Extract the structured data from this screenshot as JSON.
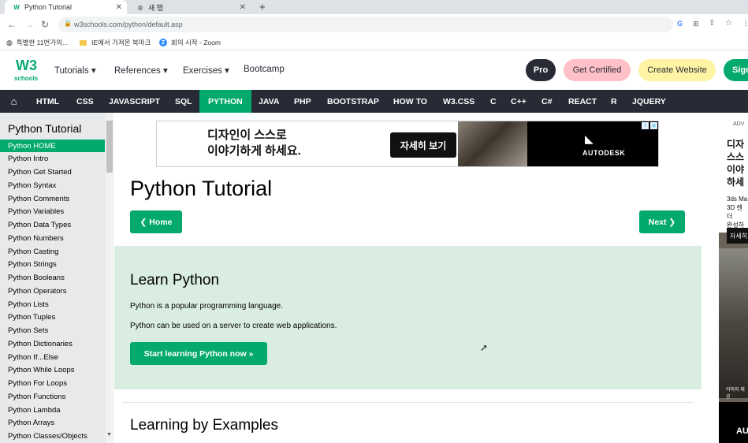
{
  "browser": {
    "tabs": [
      {
        "label": "Python Tutorial",
        "active": true
      },
      {
        "label": "새 탭",
        "active": false
      }
    ],
    "new_tab_glyph": "+",
    "url": "w3schools.com/python/default.asp",
    "bookmarks": [
      "특별한 11번가의...",
      "IE에서 가져온 북마크",
      "회의 시작 - Zoom"
    ]
  },
  "site": {
    "logo_top": "W3",
    "logo_bottom": "schools",
    "menus": [
      "Tutorials ▾",
      "References ▾",
      "Exercises ▾",
      "Bootcamp"
    ],
    "pro": "Pro",
    "get_certified": "Get Certified",
    "create_website": "Create Website",
    "sign": "Sign",
    "nav": [
      "HTML",
      "CSS",
      "JAVASCRIPT",
      "SQL",
      "PYTHON",
      "JAVA",
      "PHP",
      "BOOTSTRAP",
      "HOW TO",
      "W3.CSS",
      "C",
      "C++",
      "C#",
      "REACT",
      "R",
      "JQUERY"
    ],
    "active_nav": "PYTHON"
  },
  "sidebar": {
    "title": "Python Tutorial",
    "items": [
      "Python HOME",
      "Python Intro",
      "Python Get Started",
      "Python Syntax",
      "Python Comments",
      "Python Variables",
      "Python Data Types",
      "Python Numbers",
      "Python Casting",
      "Python Strings",
      "Python Booleans",
      "Python Operators",
      "Python Lists",
      "Python Tuples",
      "Python Sets",
      "Python Dictionaries",
      "Python If...Else",
      "Python While Loops",
      "Python For Loops",
      "Python Functions",
      "Python Lambda",
      "Python Arrays",
      "Python Classes/Objects"
    ]
  },
  "ad": {
    "line1": "디자인이 스스로",
    "line2": "이야기하게 하세요.",
    "cta": "자세히 보기",
    "brand": "AUTODESK"
  },
  "main": {
    "title": "Python Tutorial",
    "home_btn": "❮ Home",
    "next_btn": "Next ❯",
    "learn_heading": "Learn Python",
    "p1": "Python is a popular programming language.",
    "p2": "Python can be used on a server to create web applications.",
    "start_btn": "Start learning Python now »",
    "examples_heading": "Learning by Examples"
  },
  "right_ad": {
    "label": "ADV",
    "lines": [
      "디자",
      "스스",
      "이야",
      "하세"
    ],
    "sub1": "3ds Ma",
    "sub2": "3D 렌더",
    "sub3": "완성하",
    "btn": "자세히",
    "caption": "이미지 제공",
    "brand": "AU"
  },
  "colors": {
    "accent": "#04aa6d",
    "nav_bg": "#282a35",
    "learn_bg": "#d9eee1"
  }
}
